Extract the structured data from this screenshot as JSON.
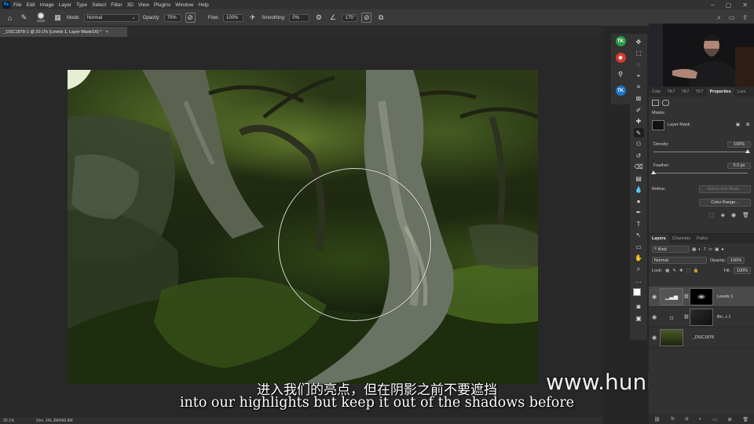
{
  "app": {
    "menu": [
      "File",
      "Edit",
      "Image",
      "Layer",
      "Type",
      "Select",
      "Filter",
      "3D",
      "View",
      "Plugins",
      "Window",
      "Help"
    ],
    "logo_text": "Ps"
  },
  "options_bar": {
    "brush_size": "2230",
    "mode_label": "Mode:",
    "mode_value": "Normal",
    "opacity_label": "Opacity:",
    "opacity_value": "70%",
    "flow_label": "Flow:",
    "flow_value": "100%",
    "smoothing_label": "Smoothing:",
    "smoothing_value": "0%",
    "angle_value": "175°"
  },
  "document": {
    "tab_title": "_DSC1878-1 @ 20.1% (Levels 1, Layer Mask/16) *",
    "zoom": "20.1%",
    "doc_info": "Doc: 241.3M/460.8M"
  },
  "subtitles": {
    "chinese": "进入我们的亮点，但在阴影之前不要遮挡",
    "english": "into our highlights but keep it out of the shadows before"
  },
  "watermark": "www.hunls.com",
  "properties_panel": {
    "tabs": [
      "Colo",
      "TK7",
      "TK7",
      "TK7",
      "Properties",
      "Lum"
    ],
    "masks_title": "Masks",
    "layer_mask_label": "Layer Mask",
    "density_label": "Density:",
    "density_value": "100%",
    "density_level": 1.0,
    "feather_label": "Feather:",
    "feather_value": "0.0 px",
    "feather_level": 0.0,
    "refine_label": "Refine:",
    "select_mask_button": "Select and Mask...",
    "color_range_button": "Color Range..."
  },
  "layers_panel": {
    "tabs": [
      "Layers",
      "Channels",
      "Paths"
    ],
    "filter_kind": "Kind",
    "blend_mode": "Normal",
    "opacity_label": "Opacity:",
    "opacity_value": "100%",
    "lock_label": "Lock:",
    "fill_label": "Fill:",
    "fill_value": "100%",
    "layers": [
      {
        "name": "Levels 1",
        "selected": true
      },
      {
        "name": "Bri...t 1",
        "selected": false
      },
      {
        "name": "_DSC1878",
        "selected": false
      }
    ]
  },
  "mini_dock": {
    "badges": [
      "TK",
      "TK"
    ]
  },
  "colors": {
    "accent": "#31a8ff",
    "panel_bg": "#323232",
    "canvas_bg": "#282828",
    "tk_green": "#2a9d4a",
    "tk_red": "#d23b2f",
    "tk_blue": "#1f74c9"
  }
}
